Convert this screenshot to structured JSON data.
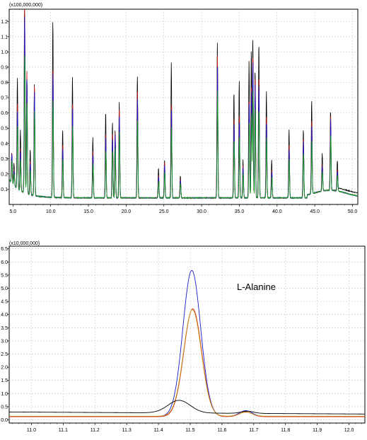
{
  "chart_data": [
    {
      "type": "line",
      "scale_label": "(x100,000,000)",
      "xlim": [
        4.5,
        50.7
      ],
      "ylim": [
        0,
        1.28
      ],
      "x_ticks": [
        5.0,
        10.0,
        15.0,
        20.0,
        25.0,
        30.0,
        35.0,
        40.0,
        45.0,
        50.0
      ],
      "x_tick_labels": [
        "5.0",
        "10.0",
        "15.0",
        "20.0",
        "25.0",
        "30.0",
        "35.0",
        "40.0",
        "45.0",
        "50.0"
      ],
      "y_ticks": [
        0.1,
        0.2,
        0.3,
        0.4,
        0.5,
        0.6,
        0.7,
        0.8,
        0.9,
        1.0,
        1.1,
        1.2
      ],
      "y_tick_labels": [
        "0.1",
        "0.2",
        "0.3",
        "0.4",
        "0.5",
        "0.6",
        "0.7",
        "0.8",
        "0.9",
        "1.0",
        "1.1",
        "1.2"
      ],
      "grid": true,
      "series_colors": [
        "#000000",
        "#d81818",
        "#1a1acc",
        "#10a020"
      ],
      "peaks": [
        [
          4.85,
          0.2
        ],
        [
          5.15,
          0.15
        ],
        [
          5.6,
          0.73
        ],
        [
          6.0,
          0.4
        ],
        [
          6.55,
          1.27
        ],
        [
          6.85,
          0.8
        ],
        [
          7.3,
          0.3
        ],
        [
          7.85,
          0.73
        ],
        [
          10.3,
          1.17
        ],
        [
          11.6,
          0.45
        ],
        [
          12.9,
          0.79
        ],
        [
          15.6,
          0.4
        ],
        [
          17.3,
          0.57
        ],
        [
          18.2,
          0.5
        ],
        [
          18.55,
          0.45
        ],
        [
          19.1,
          0.63
        ],
        [
          21.5,
          0.81
        ],
        [
          24.3,
          0.2
        ],
        [
          25.1,
          0.25
        ],
        [
          26.0,
          0.89
        ],
        [
          27.2,
          0.15
        ],
        [
          32.1,
          1.02
        ],
        [
          34.3,
          0.7
        ],
        [
          35.0,
          0.77
        ],
        [
          35.5,
          0.25
        ],
        [
          36.3,
          0.9
        ],
        [
          36.6,
          0.97
        ],
        [
          36.8,
          1.05
        ],
        [
          37.1,
          0.85
        ],
        [
          37.6,
          1.02
        ],
        [
          38.6,
          0.7
        ],
        [
          39.3,
          0.25
        ],
        [
          41.6,
          0.45
        ],
        [
          43.5,
          0.45
        ],
        [
          44.6,
          0.62
        ],
        [
          46.0,
          0.25
        ],
        [
          47.1,
          0.53
        ],
        [
          48.0,
          0.2
        ]
      ]
    },
    {
      "type": "line",
      "scale_label": "(x10,000,000)",
      "annotation": "L-Alanine",
      "xlim": [
        10.93,
        12.05
      ],
      "ylim": [
        -0.12,
        6.6
      ],
      "x_ticks": [
        11.0,
        11.1,
        11.2,
        11.3,
        11.4,
        11.5,
        11.6,
        11.7,
        11.8,
        11.9,
        12.0
      ],
      "x_tick_labels": [
        "11.0",
        "11.1",
        "11.2",
        "11.3",
        "11.4",
        "11.5",
        "11.6",
        "11.7",
        "11.8",
        "11.9",
        "12.0"
      ],
      "y_ticks": [
        0.0,
        0.5,
        1.0,
        1.5,
        2.0,
        2.5,
        3.0,
        3.5,
        4.0,
        4.5,
        5.0,
        5.5,
        6.0,
        6.5
      ],
      "y_tick_labels": [
        "0.0",
        "0.5",
        "1.0",
        "1.5",
        "2.0",
        "2.5",
        "3.0",
        "3.5",
        "4.0",
        "4.5",
        "5.0",
        "5.5",
        "6.0",
        "6.5"
      ],
      "grid": true,
      "series": [
        {
          "color": "#1a1acc",
          "baseline": 0.13,
          "peaks": [
            [
              11.505,
              5.55
            ],
            [
              11.675,
              0.22
            ]
          ]
        },
        {
          "color": "#d81818",
          "baseline": 0.12,
          "peaks": [
            [
              11.508,
              4.1
            ],
            [
              11.675,
              0.18
            ]
          ]
        },
        {
          "color": "#c8a020",
          "baseline": 0.14,
          "peaks": [
            [
              11.507,
              4.05
            ],
            [
              11.675,
              0.15
            ]
          ]
        },
        {
          "color": "#000000",
          "baseline": 0.3,
          "peaks": [
            [
              11.465,
              0.48
            ],
            [
              11.68,
              0.08
            ]
          ]
        }
      ]
    }
  ]
}
